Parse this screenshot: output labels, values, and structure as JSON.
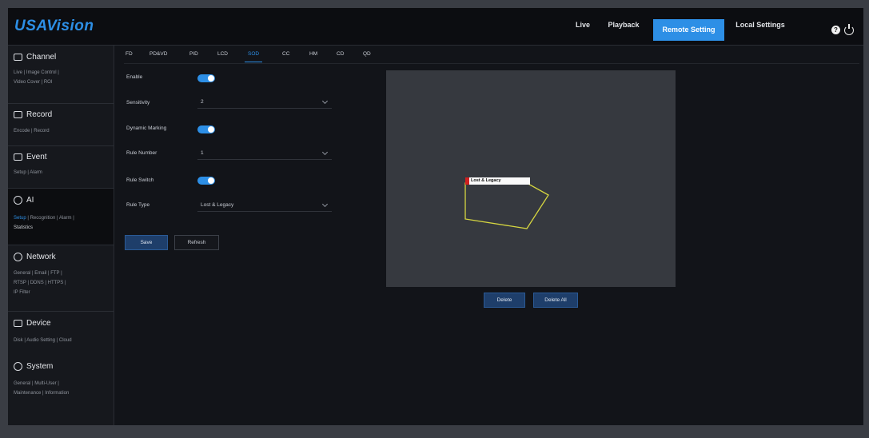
{
  "brand": {
    "logo": "USAVision"
  },
  "nav": {
    "live": "Live",
    "playback": "Playback",
    "remote_setting": "Remote Setting",
    "local_settings": "Local Settings",
    "help": "?"
  },
  "sidebar": {
    "channel": {
      "title": "Channel",
      "links": [
        "Live",
        "Image Control",
        "Video Cover",
        "ROI"
      ]
    },
    "record": {
      "title": "Record",
      "links": [
        "Encode",
        "Record"
      ]
    },
    "event": {
      "title": "Event",
      "links": [
        "Setup",
        "Alarm"
      ]
    },
    "ai": {
      "title": "AI",
      "links": [
        "Setup",
        "Recognition",
        "Alarm",
        "Statistics"
      ]
    },
    "network": {
      "title": "Network",
      "links": [
        "General",
        "Email",
        "FTP",
        "RTSP",
        "DDNS",
        "HTTPS",
        "IP Filter"
      ]
    },
    "device": {
      "title": "Device",
      "links": [
        "Disk",
        "Audio Setting",
        "Cloud"
      ]
    },
    "system": {
      "title": "System",
      "links": [
        "General",
        "Multi-User",
        "Maintenance",
        "Information"
      ]
    },
    "separator": "|"
  },
  "tabs": [
    "FD",
    "PD&VD",
    "PID",
    "LCD",
    "SOD",
    "CC",
    "HM",
    "CD",
    "QD"
  ],
  "active_tab": "SOD",
  "form": {
    "enable_label": "Enable",
    "enable_on": true,
    "sensitivity_label": "Sensitivity",
    "sensitivity_value": "2",
    "dynamic_marking_label": "Dynamic Marking",
    "dynamic_marking_on": true,
    "rule_number_label": "Rule Number",
    "rule_number_value": "1",
    "rule_switch_label": "Rule Switch",
    "rule_switch_on": true,
    "rule_type_label": "Rule Type",
    "rule_type_value": "Lost & Legacy"
  },
  "buttons": {
    "save": "Save",
    "refresh": "Refresh",
    "delete": "Delete",
    "delete_all": "Delete All"
  },
  "preview": {
    "roi_label": "Lost & Legacy",
    "roi_color": "#d6d640",
    "marker_color": "#d02020"
  },
  "colors": {
    "accent": "#2d8fe6",
    "background": "#121419",
    "panel": "#36393f"
  }
}
